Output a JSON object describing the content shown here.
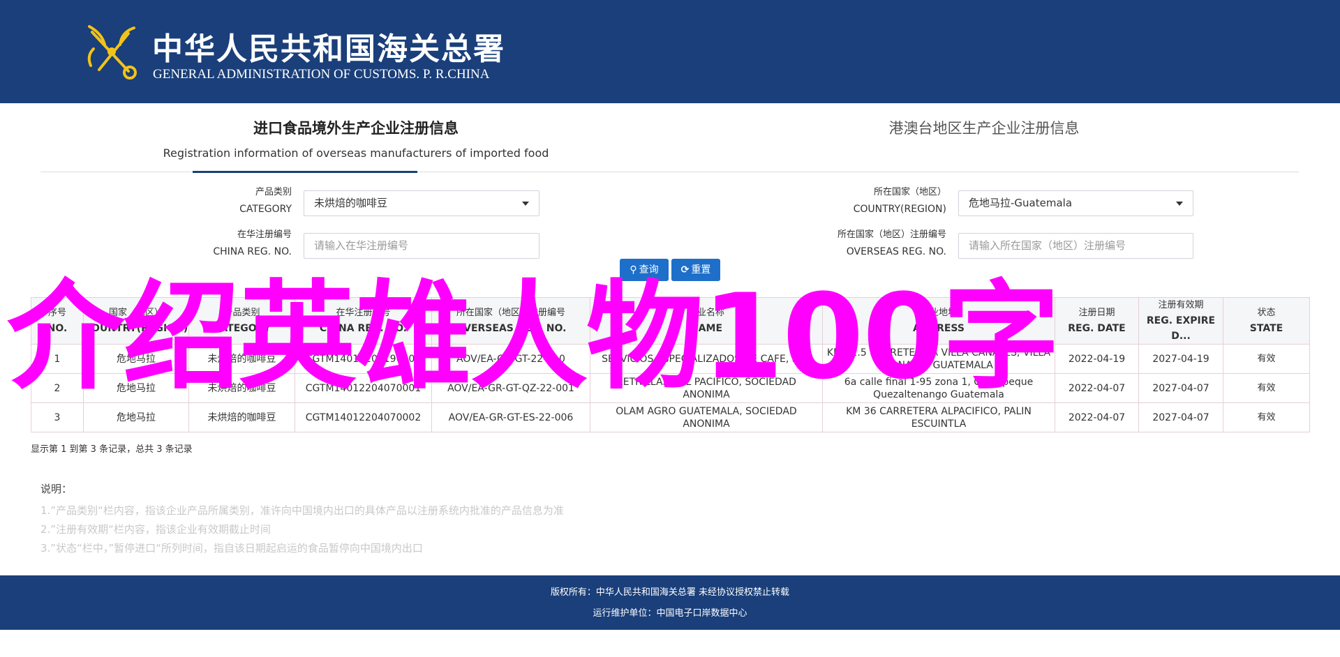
{
  "header": {
    "title_cn": "中华人民共和国海关总署",
    "title_en": "GENERAL ADMINISTRATION OF CUSTOMS. P. R.CHINA",
    "emblem": "customs-emblem-icon"
  },
  "tabs": [
    {
      "label_cn": "进口食品境外生产企业注册信息",
      "label_en": "Registration information of overseas manufacturers of imported food",
      "active": true
    },
    {
      "label_cn": "港澳台地区生产企业注册信息",
      "active": false
    }
  ],
  "form": {
    "category": {
      "label_cn": "产品类别",
      "label_en": "CATEGORY",
      "value": "未烘焙的咖啡豆"
    },
    "country": {
      "label_cn": "所在国家（地区）",
      "label_en": "COUNTRY(REGION)",
      "value": "危地马拉-Guatemala"
    },
    "china_reg": {
      "label_cn": "在华注册编号",
      "label_en": "CHINA REG. NO.",
      "placeholder": "请输入在华注册编号"
    },
    "overseas_reg": {
      "label_cn": "所在国家（地区）注册编号",
      "label_en": "OVERSEAS REG. NO.",
      "placeholder": "请输入所在国家（地区）注册编号"
    },
    "search_label": "查询",
    "reset_label": "重置"
  },
  "table": {
    "headers": [
      {
        "cn": "序号",
        "en": "NO."
      },
      {
        "cn": "国家（地区）",
        "en": "COUNTRY(REGION)"
      },
      {
        "cn": "产品类别",
        "en": "CATEGORY"
      },
      {
        "cn": "在华注册编号",
        "en": "CHINA REG. NO."
      },
      {
        "cn": "所在国家（地区）注册编号",
        "en": "OVERSEAS REG. NO."
      },
      {
        "cn": "企业名称",
        "en": "NAME"
      },
      {
        "cn": "企业地址",
        "en": "ADDRESS"
      },
      {
        "cn": "注册日期",
        "en": "REG. DATE"
      },
      {
        "cn": "注册有效期",
        "en": "REG. EXPIRE D..."
      },
      {
        "cn": "状态",
        "en": "STATE"
      }
    ],
    "rows": [
      [
        "1",
        "危地马拉",
        "未烘焙的咖啡豆",
        "CGTM14012204190003",
        "AOV/EA-GR-GT-22-010",
        "SERVICIOS ESPECIALIZADOS DE CAFE, S.A.",
        "KM 21.5 CARRETERA A VILLA CANALES, VILLA CANALES GUATEMALA",
        "2022-04-19",
        "2027-04-19",
        "有效"
      ],
      [
        "2",
        "危地马拉",
        "未烘焙的咖啡豆",
        "CGTM14012204070001",
        "AOV/EA-GR-GT-QZ-22-001",
        "RETRILLAS DEL PACIFICO, SOCIEDAD ANONIMA",
        "6a calle final 1-95 zona 1, Coatepeque Quezaltenango Guatemala",
        "2022-04-07",
        "2027-04-07",
        "有效"
      ],
      [
        "3",
        "危地马拉",
        "未烘焙的咖啡豆",
        "CGTM14012204070002",
        "AOV/EA-GR-GT-ES-22-006",
        "OLAM AGRO GUATEMALA, SOCIEDAD ANONIMA",
        "KM 36 CARRETERA ALPACIFICO, PALIN ESCUINTLA",
        "2022-04-07",
        "2027-04-07",
        "有效"
      ]
    ]
  },
  "pager_text": "显示第 1 到第 3 条记录，总共 3 条记录",
  "notes": {
    "title": "说明：",
    "lines": [
      "1.”产品类别“栏内容，指该企业产品所属类别，准许向中国境内出口的具体产品以注册系统内批准的产品信息为准",
      "2.”注册有效期“栏内容，指该企业有效期截止时间",
      "3.”状态“栏中，”暂停进口“所列时间，指自该日期起启运的食品暂停向中国境内出口"
    ]
  },
  "overlay_text": "介绍英雄人物100字",
  "footer": {
    "copyright": "版权所有：中华人民共和国海关总署 未经协议授权禁止转载",
    "maintainer": "运行维护单位：中国电子口岸数据中心"
  },
  "colors": {
    "header_bg": "#1a3f7a",
    "button_bg": "#1e6fc9",
    "overlay": "#ff00ff"
  }
}
